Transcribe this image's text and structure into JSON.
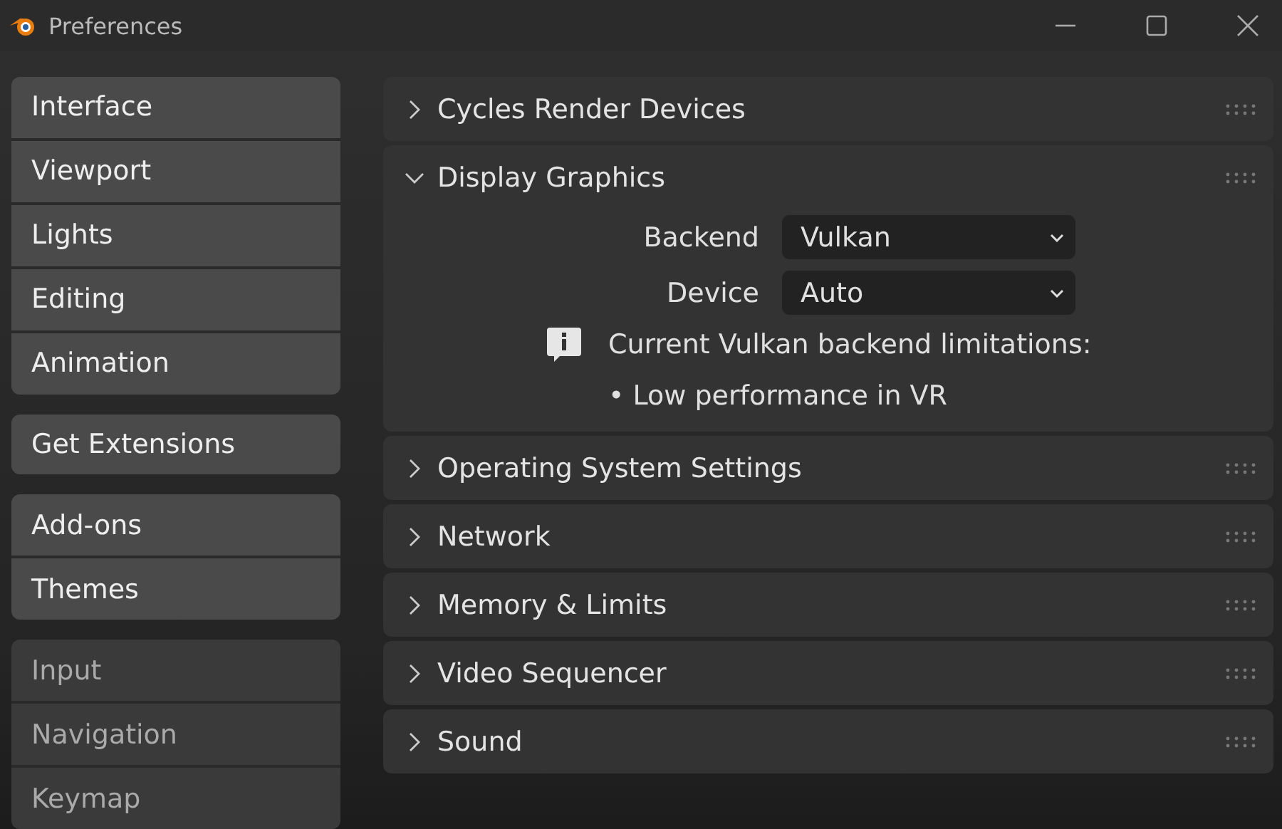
{
  "window": {
    "title": "Preferences"
  },
  "sidebar": {
    "groups": [
      {
        "items": [
          {
            "label": "Interface"
          },
          {
            "label": "Viewport"
          },
          {
            "label": "Lights"
          },
          {
            "label": "Editing"
          },
          {
            "label": "Animation"
          }
        ]
      },
      {
        "items": [
          {
            "label": "Get Extensions"
          }
        ]
      },
      {
        "items": [
          {
            "label": "Add-ons"
          },
          {
            "label": "Themes"
          }
        ]
      },
      {
        "items": [
          {
            "label": "Input"
          },
          {
            "label": "Navigation"
          },
          {
            "label": "Keymap"
          }
        ]
      }
    ]
  },
  "panels": [
    {
      "title": "Cycles Render Devices",
      "expanded": false
    },
    {
      "title": "Display Graphics",
      "expanded": true,
      "fields": [
        {
          "label": "Backend",
          "value": "Vulkan"
        },
        {
          "label": "Device",
          "value": "Auto"
        }
      ],
      "info": {
        "message": "Current Vulkan backend limitations:",
        "bullets": [
          "• Low performance in VR"
        ]
      }
    },
    {
      "title": "Operating System Settings",
      "expanded": false
    },
    {
      "title": "Network",
      "expanded": false
    },
    {
      "title": "Memory & Limits",
      "expanded": false
    },
    {
      "title": "Video Sequencer",
      "expanded": false
    },
    {
      "title": "Sound",
      "expanded": false
    }
  ]
}
